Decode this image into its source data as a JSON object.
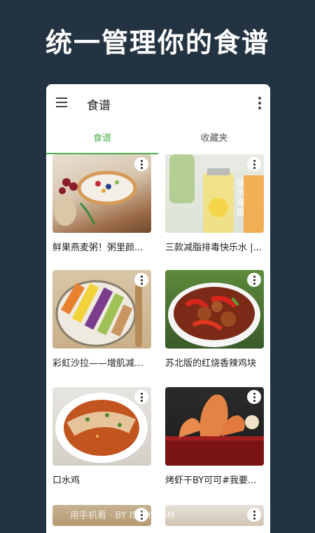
{
  "hero_title": "统一管理你的食谱",
  "appbar": {
    "title": "食谱",
    "menu_icon": "hamburger-menu-icon",
    "more_icon": "more-vert-icon"
  },
  "tabs": [
    {
      "label": "食谱",
      "active": true
    },
    {
      "label": "收藏夹",
      "active": false
    }
  ],
  "colors": {
    "background": "#243342",
    "accent": "#4caf50"
  },
  "recipes": [
    {
      "title": "鲜果燕麦粥！粥里颜..."
    },
    {
      "title": "三款减脂排毒快乐水 |..."
    },
    {
      "title": "彩虹沙拉——增肌减脂..."
    },
    {
      "title": "苏北版的红烧香辣鸡块"
    },
    {
      "title": "口水鸡"
    },
    {
      "title": "烤虾干BY可可#我要..."
    }
  ],
  "watermark": "用手机看 · BY ISJXY.COM"
}
